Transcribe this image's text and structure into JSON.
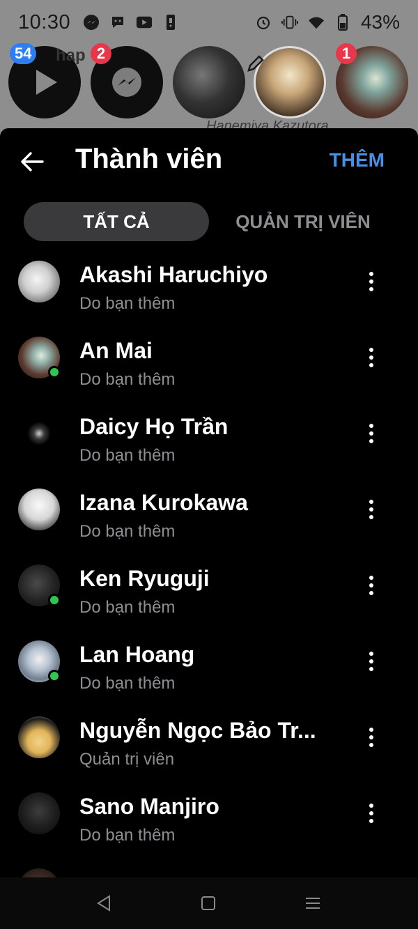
{
  "status_bar": {
    "time": "10:30",
    "battery": "43%",
    "left_icons": [
      "messenger-icon",
      "chat-bubble-icon",
      "youtube-icon",
      "phone-icon"
    ],
    "right_icons": [
      "alarm-icon",
      "vibrate-icon",
      "wifi-icon",
      "battery-icon"
    ]
  },
  "background": {
    "snippet": "hap",
    "name": "Hanemiya Kazutora",
    "story_badges": [
      "54",
      "2",
      "1"
    ]
  },
  "header": {
    "title": "Thành viên",
    "add_label": "THÊM",
    "back_icon": "arrow-left-icon"
  },
  "tabs": [
    {
      "label": "TẤT CẢ",
      "selected": true
    },
    {
      "label": "QUẢN TRỊ VIÊN",
      "selected": false
    }
  ],
  "members": [
    {
      "name": "Akashi Haruchiyo",
      "subtitle": "Do bạn thêm",
      "online": false
    },
    {
      "name": "An Mai",
      "subtitle": "Do bạn thêm",
      "online": true
    },
    {
      "name": "Daicy Họ Trần",
      "subtitle": "Do bạn thêm",
      "online": false
    },
    {
      "name": "Izana Kurokawa",
      "subtitle": "Do bạn thêm",
      "online": false
    },
    {
      "name": "Ken Ryuguji",
      "subtitle": "Do bạn thêm",
      "online": true
    },
    {
      "name": "Lan Hoang",
      "subtitle": "Do bạn thêm",
      "online": true
    },
    {
      "name": "Nguyễn Ngọc Bảo Tr...",
      "subtitle": "Quản trị viên",
      "online": false
    },
    {
      "name": "Sano Manjiro",
      "subtitle": "Do bạn thêm",
      "online": false
    }
  ],
  "colors": {
    "accent": "#4a90e2",
    "online": "#31c652",
    "tab_selected_bg": "#3a3a3c",
    "muted_text": "#8e8e93"
  }
}
